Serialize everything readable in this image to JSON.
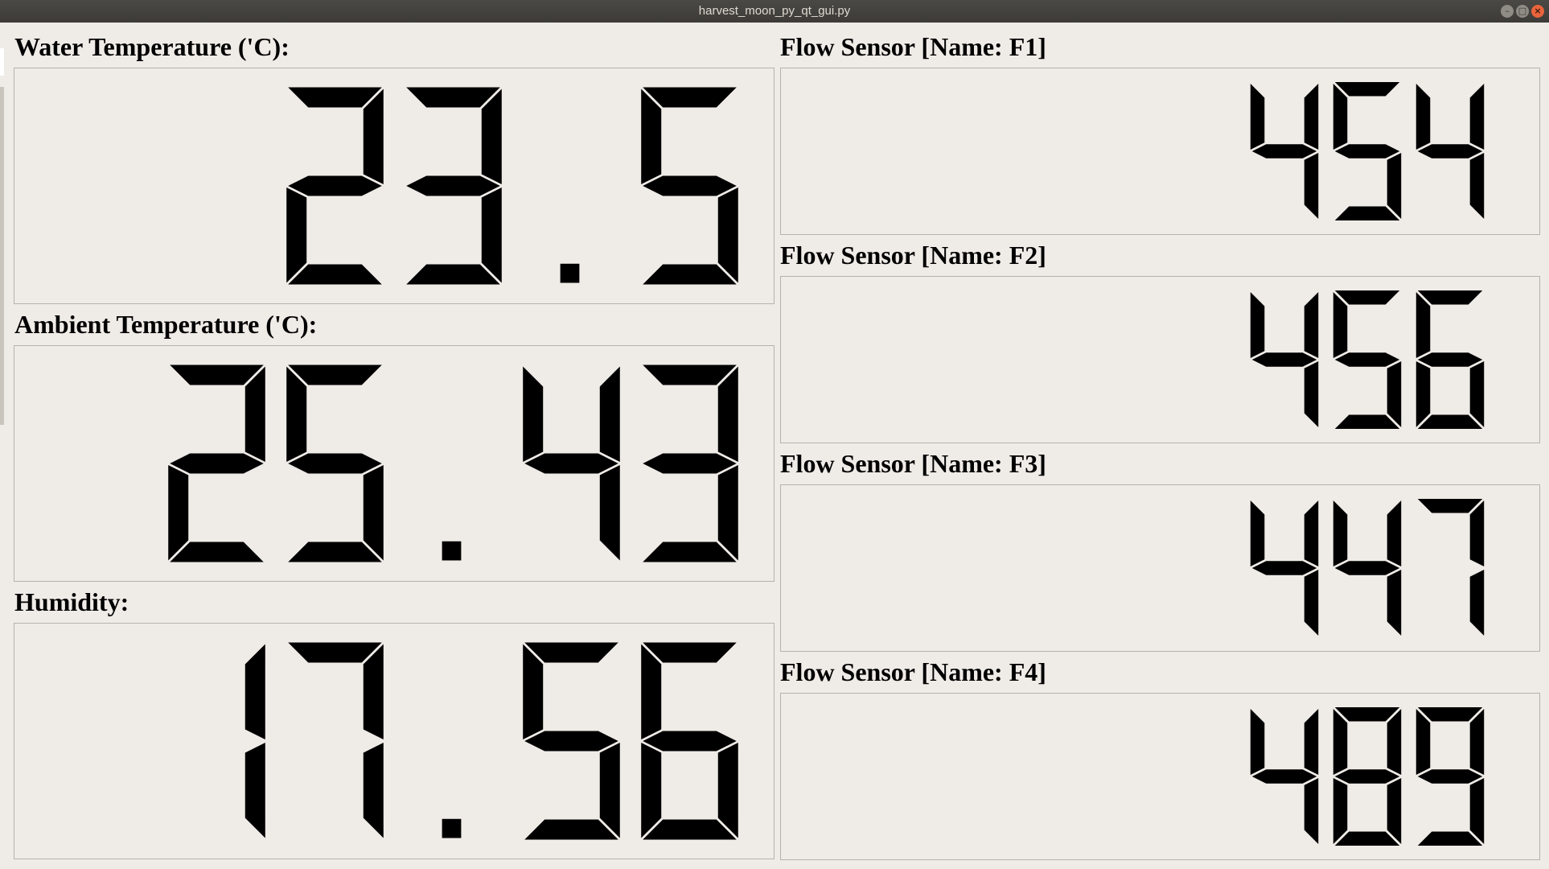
{
  "window": {
    "title": "harvest_moon_py_qt_gui.py",
    "controls": {
      "minimize_icon": "–",
      "maximize_icon": "□",
      "close_icon": "×"
    }
  },
  "sensors": {
    "water_temp": {
      "label": "Water Temperature ('C):",
      "value": "23.5"
    },
    "ambient_temp": {
      "label": "Ambient Temperature ('C):",
      "value": "25.43"
    },
    "humidity": {
      "label": "Humidity:",
      "value": "17.56"
    },
    "flow_f1": {
      "label": "Flow Sensor [Name: F1]",
      "value": "454"
    },
    "flow_f2": {
      "label": "Flow Sensor [Name: F2]",
      "value": "456"
    },
    "flow_f3": {
      "label": "Flow Sensor [Name: F3]",
      "value": "447"
    },
    "flow_f4": {
      "label": "Flow Sensor [Name: F4]",
      "value": "489"
    }
  }
}
